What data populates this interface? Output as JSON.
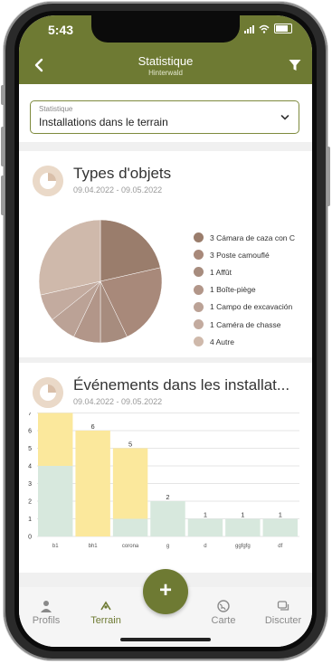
{
  "status_bar": {
    "time": "5:43"
  },
  "header": {
    "title": "Statistique",
    "subtitle": "Hinterwald",
    "back_icon": "chevron-left-icon",
    "filter_icon": "filter-icon"
  },
  "select": {
    "label": "Statistique",
    "value": "Installations dans le terrain"
  },
  "card1": {
    "title": "Types d'objets",
    "date_range": "09.04.2022 - 09.05.2022",
    "chart_data": {
      "type": "pie",
      "slices": [
        {
          "label": "3 Cámara de caza con C",
          "value": 3,
          "color": "#9a7d6c"
        },
        {
          "label": "3 Poste camouflé",
          "value": 3,
          "color": "#a8897a"
        },
        {
          "label": "1 Affût",
          "value": 1,
          "color": "#a78c7e"
        },
        {
          "label": "1 Boîte-piège",
          "value": 1,
          "color": "#b29689"
        },
        {
          "label": "1 Campo de excavación",
          "value": 1,
          "color": "#bba296"
        },
        {
          "label": "1 Caméra de chasse",
          "value": 1,
          "color": "#c3ab9f"
        },
        {
          "label": "4 Autre",
          "value": 4,
          "color": "#cfb9ab"
        }
      ]
    }
  },
  "card2": {
    "title": "Événements dans les installat...",
    "date_range": "09.04.2022 - 09.05.2022",
    "chart_data": {
      "type": "bar",
      "stacked": true,
      "categories": [
        "b1",
        "bh1",
        "corona",
        "g",
        "d",
        "ggfgfg",
        "df"
      ],
      "totals": [
        7,
        6,
        5,
        2,
        1,
        1,
        1
      ],
      "series": [
        {
          "values": [
            4,
            0,
            1,
            2,
            1,
            1,
            1
          ],
          "color": "#d7e8dd"
        },
        {
          "values": [
            3,
            6,
            4,
            0,
            0,
            0,
            0
          ],
          "color": "#fbe89c"
        }
      ],
      "ylim": [
        0,
        7
      ],
      "yticks": [
        0,
        1,
        2,
        3,
        4,
        5,
        6,
        7
      ],
      "grid": true
    }
  },
  "nav": {
    "profils": "Profils",
    "terrain": "Terrain",
    "fab": "+",
    "carte": "Carte",
    "discuter": "Discuter"
  }
}
